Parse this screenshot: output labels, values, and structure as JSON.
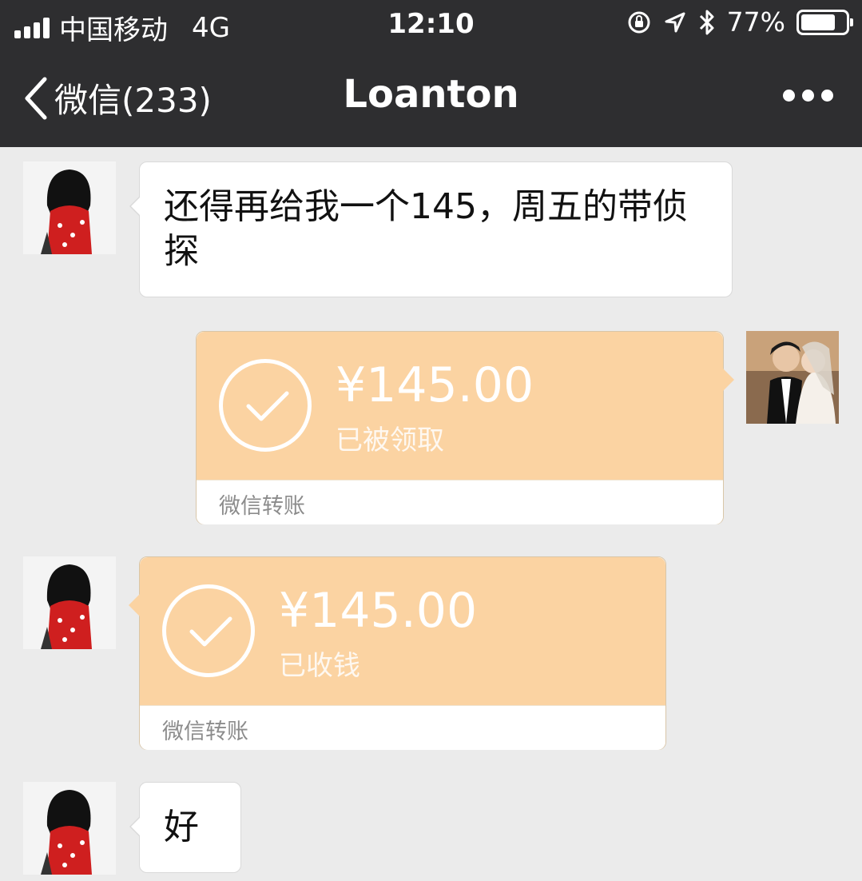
{
  "status_bar": {
    "carrier": "中国移动",
    "network": "4G",
    "time": "12:10",
    "battery_percent": "77%",
    "battery_level": 0.77
  },
  "nav": {
    "back_label": "微信(233)",
    "title": "Loanton"
  },
  "messages": [
    {
      "type": "text",
      "from": "contact",
      "text": "还得再给我一个145，周五的带侦探"
    },
    {
      "type": "transfer",
      "from": "me",
      "amount": "¥145.00",
      "status": "已被领取",
      "footer": "微信转账"
    },
    {
      "type": "transfer",
      "from": "contact",
      "amount": "¥145.00",
      "status": "已收钱",
      "footer": "微信转账"
    },
    {
      "type": "text",
      "from": "contact",
      "text": "好"
    }
  ],
  "colors": {
    "header_bg": "#2e2e30",
    "chat_bg": "#ebebeb",
    "transfer_bg": "#fbd3a2"
  }
}
